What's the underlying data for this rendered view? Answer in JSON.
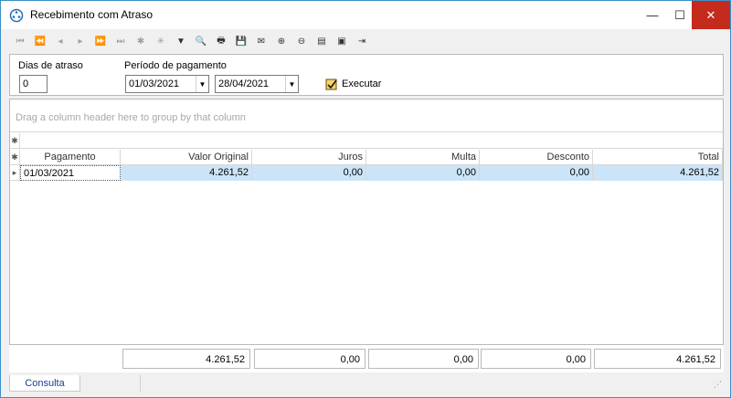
{
  "window": {
    "title": "Recebimento com Atraso",
    "min_glyph": "—",
    "max_glyph": "☐",
    "close_glyph": "✕"
  },
  "toolbar": {
    "buttons": [
      {
        "name": "first-record-icon",
        "glyph": "⏮"
      },
      {
        "name": "prev-page-icon",
        "glyph": "⏪"
      },
      {
        "name": "prev-record-icon",
        "glyph": "◂"
      },
      {
        "name": "next-record-icon",
        "glyph": "▸"
      },
      {
        "name": "next-page-icon",
        "glyph": "⏩"
      },
      {
        "name": "last-record-icon",
        "glyph": "⏭"
      },
      {
        "name": "insert-record-icon",
        "glyph": "✱"
      },
      {
        "name": "delete-record-icon",
        "glyph": "✳"
      },
      {
        "name": "filter-icon",
        "glyph": "▼"
      },
      {
        "name": "print-preview-icon",
        "glyph": "🔍"
      },
      {
        "name": "print-icon",
        "glyph": "🖶"
      },
      {
        "name": "export-icon",
        "glyph": "💾"
      },
      {
        "name": "email-icon",
        "glyph": "✉"
      },
      {
        "name": "zoom-in-icon",
        "glyph": "⊕"
      },
      {
        "name": "zoom-out-icon",
        "glyph": "⊖"
      },
      {
        "name": "report-icon",
        "glyph": "▤"
      },
      {
        "name": "window-icon",
        "glyph": "▣"
      },
      {
        "name": "exit-icon",
        "glyph": "⇥"
      }
    ]
  },
  "params": {
    "dias_label": "Dias de atraso",
    "dias_value": "0",
    "periodo_label": "Período de pagamento",
    "date_from": "01/03/2021",
    "date_to": "28/04/2021",
    "executar_label": "Executar"
  },
  "grid": {
    "group_hint": "Drag a column header here to group by that column",
    "columns": [
      "Pagamento",
      "Valor Original",
      "Juros",
      "Multa",
      "Desconto",
      "Total"
    ],
    "rows": [
      [
        "01/03/2021",
        "4.261,52",
        "0,00",
        "0,00",
        "0,00",
        "4.261,52"
      ]
    ],
    "totals": [
      "4.261,52",
      "0,00",
      "0,00",
      "0,00",
      "4.261,52"
    ]
  },
  "tabs": {
    "consulta": "Consulta"
  },
  "colors": {
    "selection": "#cce4f7",
    "close_button": "#c42b1c",
    "window_border": "#3c8fc9"
  }
}
